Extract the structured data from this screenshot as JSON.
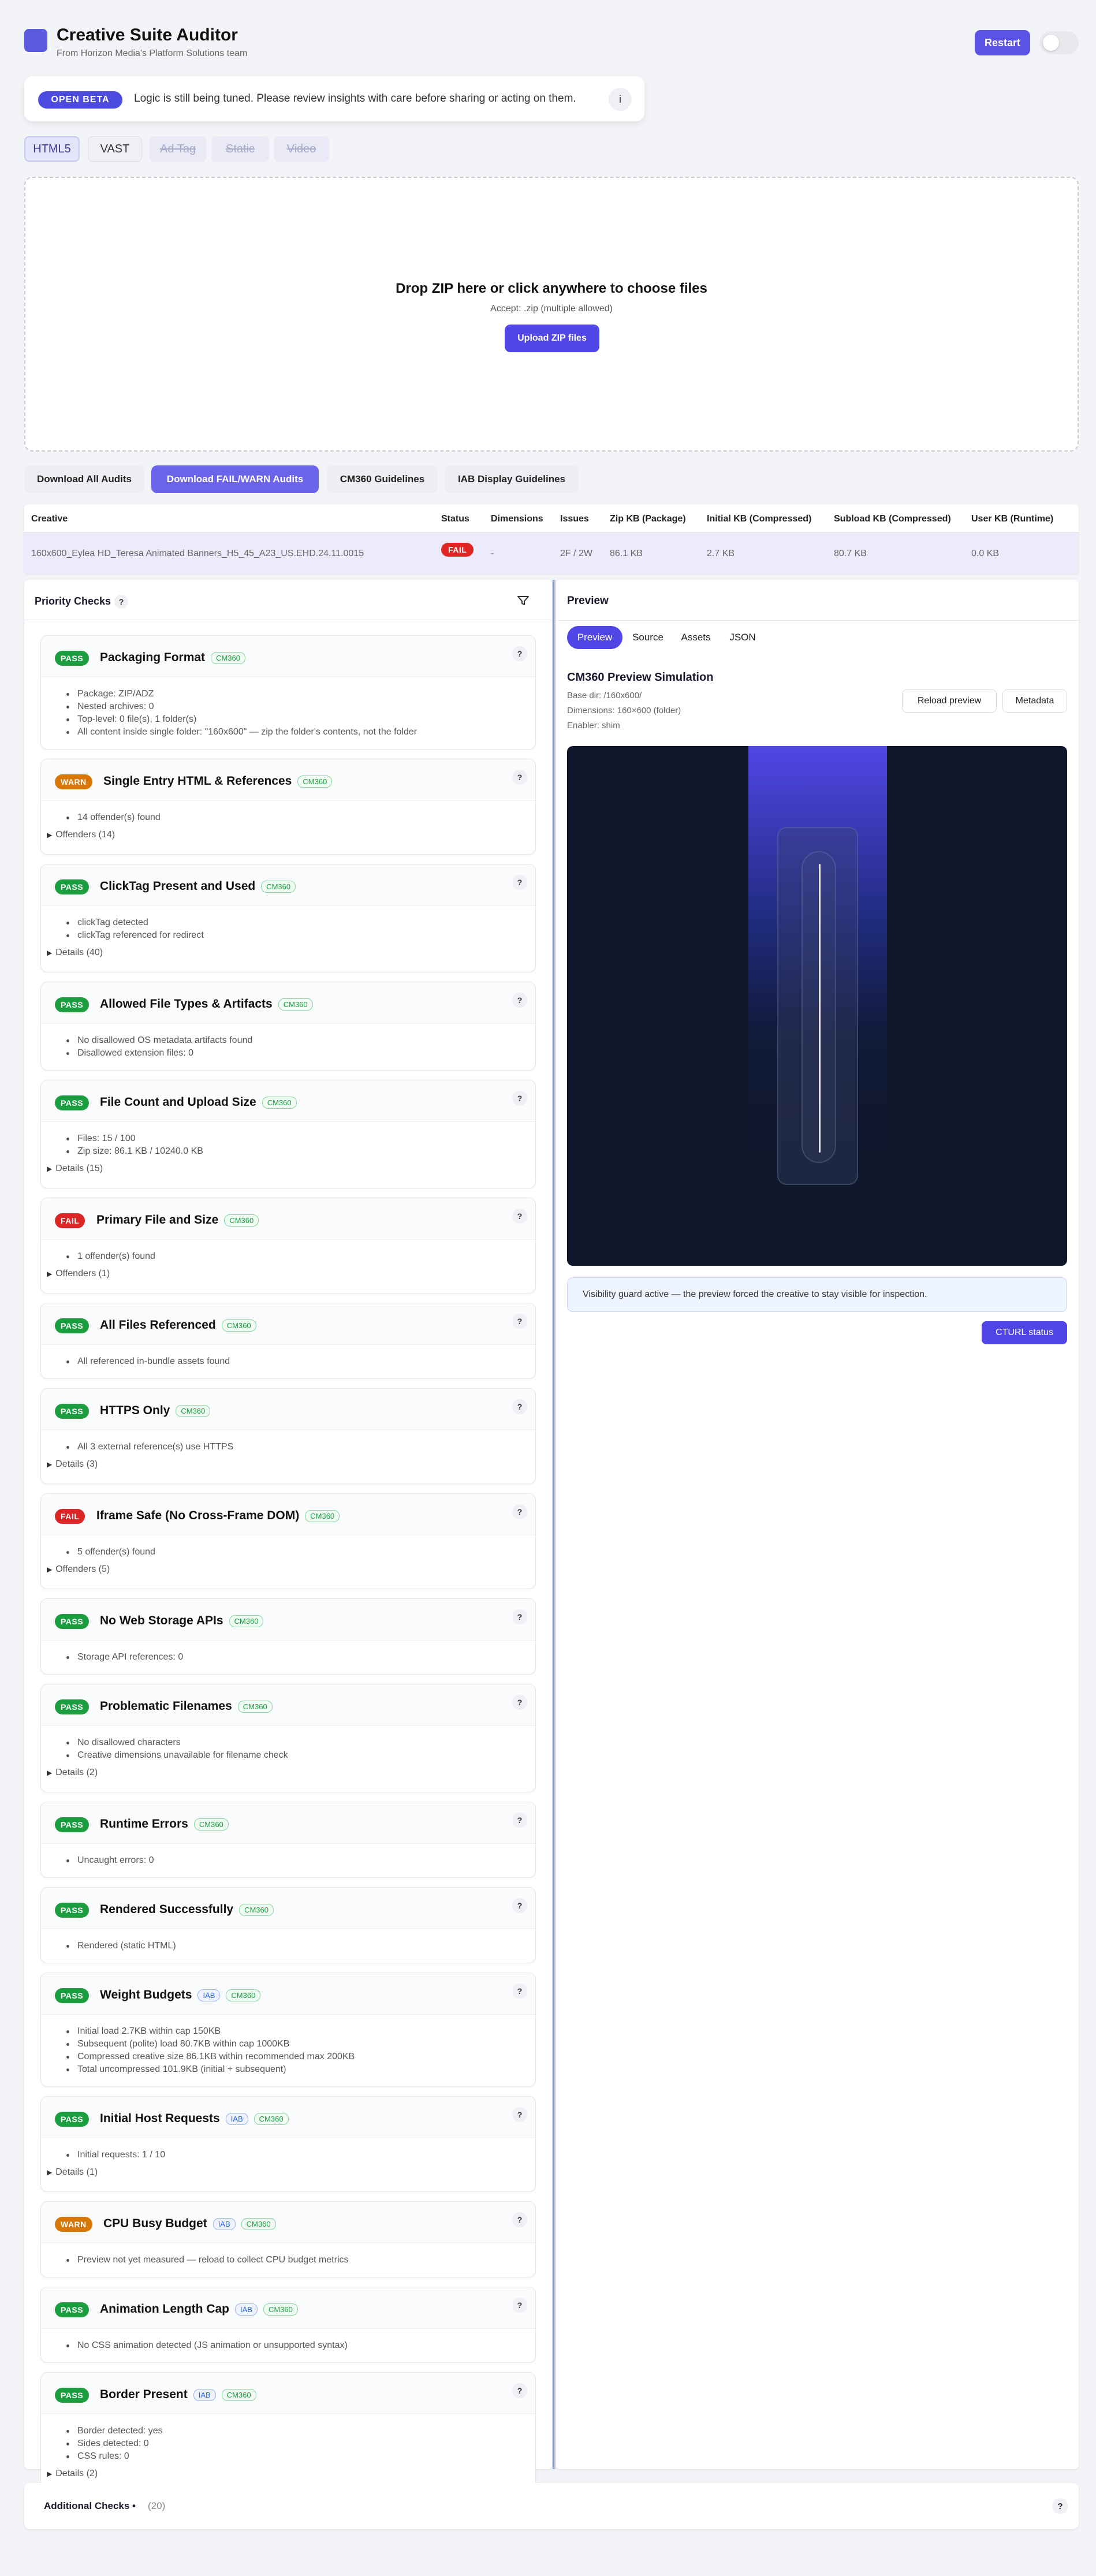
{
  "app": {
    "title": "Creative Suite Auditor",
    "subtitle": "From Horizon Media's Platform Solutions team",
    "restart_label": "Restart"
  },
  "beta": {
    "badge": "OPEN BETA",
    "text": "Logic is still being tuned. Please review insights with care before sharing or acting on them.",
    "info_icon": "i"
  },
  "format_tabs": [
    "HTML5",
    "VAST",
    "Ad Tag",
    "Static",
    "Video"
  ],
  "dropzone": {
    "title": "Drop ZIP here or click anywhere to choose files",
    "accept": "Accept: .zip (multiple allowed)",
    "button": "Upload ZIP files"
  },
  "actions": [
    "Download All Audits",
    "Download FAIL/WARN Audits",
    "CM360 Guidelines",
    "IAB Display Guidelines"
  ],
  "table": {
    "headers": [
      "Creative",
      "Status",
      "Dimensions",
      "Issues",
      "Zip KB (Package)",
      "Initial KB (Compressed)",
      "Subload KB (Compressed)",
      "User KB (Runtime)"
    ],
    "row": [
      "160x600_Eylea HD_Teresa Animated Banners_H5_45_A23_US.EHD.24.11.0015",
      "FAIL",
      "-",
      "2F / 2W",
      "86.1 KB",
      "2.7 KB",
      "80.7 KB",
      "0.0 KB"
    ]
  },
  "priority": {
    "title": "Priority Checks",
    "help": "?"
  },
  "checks": [
    {
      "status": "PASS",
      "title": "Packaging Format",
      "tags": [
        "CM360"
      ],
      "bullets": [
        "Package: ZIP/ADZ",
        "Nested archives: 0",
        "Top-level: 0 file(s), 1 folder(s)",
        "All content inside single folder: \"160x600\" — zip the folder's contents, not the folder"
      ],
      "details": ""
    },
    {
      "status": "WARN",
      "title": "Single Entry HTML & References",
      "tags": [
        "CM360"
      ],
      "bullets": [
        "14 offender(s) found"
      ],
      "details": "Offenders (14)"
    },
    {
      "status": "PASS",
      "title": "ClickTag Present and Used",
      "tags": [
        "CM360"
      ],
      "bullets": [
        "clickTag detected",
        "clickTag referenced for redirect"
      ],
      "details": "Details (40)"
    },
    {
      "status": "PASS",
      "title": "Allowed File Types & Artifacts",
      "tags": [
        "CM360"
      ],
      "bullets": [
        "No disallowed OS metadata artifacts found",
        "Disallowed extension files: 0"
      ],
      "details": ""
    },
    {
      "status": "PASS",
      "title": "File Count and Upload Size",
      "tags": [
        "CM360"
      ],
      "bullets": [
        "Files: 15 / 100",
        "Zip size: 86.1 KB / 10240.0 KB"
      ],
      "details": "Details (15)"
    },
    {
      "status": "FAIL",
      "title": "Primary File and Size",
      "tags": [
        "CM360"
      ],
      "bullets": [
        "1 offender(s) found"
      ],
      "details": "Offenders (1)"
    },
    {
      "status": "PASS",
      "title": "All Files Referenced",
      "tags": [
        "CM360"
      ],
      "bullets": [
        "All referenced in-bundle assets found"
      ],
      "details": ""
    },
    {
      "status": "PASS",
      "title": "HTTPS Only",
      "tags": [
        "CM360"
      ],
      "bullets": [
        "All 3 external reference(s) use HTTPS"
      ],
      "details": "Details (3)"
    },
    {
      "status": "FAIL",
      "title": "Iframe Safe (No Cross-Frame DOM)",
      "tags": [
        "CM360"
      ],
      "bullets": [
        "5 offender(s) found"
      ],
      "details": "Offenders (5)"
    },
    {
      "status": "PASS",
      "title": "No Web Storage APIs",
      "tags": [
        "CM360"
      ],
      "bullets": [
        "Storage API references: 0"
      ],
      "details": ""
    },
    {
      "status": "PASS",
      "title": "Problematic Filenames",
      "tags": [
        "CM360"
      ],
      "bullets": [
        "No disallowed characters",
        "Creative dimensions unavailable for filename check"
      ],
      "details": "Details (2)"
    },
    {
      "status": "PASS",
      "title": "Runtime Errors",
      "tags": [
        "CM360"
      ],
      "bullets": [
        "Uncaught errors: 0"
      ],
      "details": ""
    },
    {
      "status": "PASS",
      "title": "Rendered Successfully",
      "tags": [
        "CM360"
      ],
      "bullets": [
        "Rendered (static HTML)"
      ],
      "details": ""
    },
    {
      "status": "PASS",
      "title": "Weight Budgets",
      "tags": [
        "IAB",
        "CM360"
      ],
      "bullets": [
        "Initial load 2.7KB within cap 150KB",
        "Subsequent (polite) load 80.7KB within cap 1000KB",
        "Compressed creative size 86.1KB within recommended max 200KB",
        "Total uncompressed 101.9KB (initial + subsequent)"
      ],
      "details": ""
    },
    {
      "status": "PASS",
      "title": "Initial Host Requests",
      "tags": [
        "IAB",
        "CM360"
      ],
      "bullets": [
        "Initial requests: 1 / 10"
      ],
      "details": "Details (1)"
    },
    {
      "status": "WARN",
      "title": "CPU Busy Budget",
      "tags": [
        "IAB",
        "CM360"
      ],
      "bullets": [
        "Preview not yet measured — reload to collect CPU budget metrics"
      ],
      "details": ""
    },
    {
      "status": "PASS",
      "title": "Animation Length Cap",
      "tags": [
        "IAB",
        "CM360"
      ],
      "bullets": [
        "No CSS animation detected (JS animation or unsupported syntax)"
      ],
      "details": ""
    },
    {
      "status": "PASS",
      "title": "Border Present",
      "tags": [
        "IAB",
        "CM360"
      ],
      "bullets": [
        "Border detected: yes",
        "Sides detected: 0",
        "CSS rules: 0"
      ],
      "details": "Details (2)"
    }
  ],
  "preview": {
    "title": "Preview",
    "tabs": [
      "Preview",
      "Source",
      "Assets",
      "JSON"
    ],
    "sim_title": "CM360 Preview Simulation",
    "meta": [
      "Base dir: /160x600/",
      "Dimensions: 160×600 (folder)",
      "Enabler: shim"
    ],
    "reload": "Reload preview",
    "metadata": "Metadata",
    "visibility": "Visibility guard active — the preview forced the creative to stay visible for inspection.",
    "cturl": "CTURL status"
  },
  "additional": {
    "title": "Additional Checks",
    "bullet": "•",
    "count": "(20)",
    "help": "?"
  },
  "colors": {
    "accent": "#4f46e5",
    "pass": "#1a9e3f",
    "warn": "#d97706",
    "fail": "#dc2626"
  }
}
